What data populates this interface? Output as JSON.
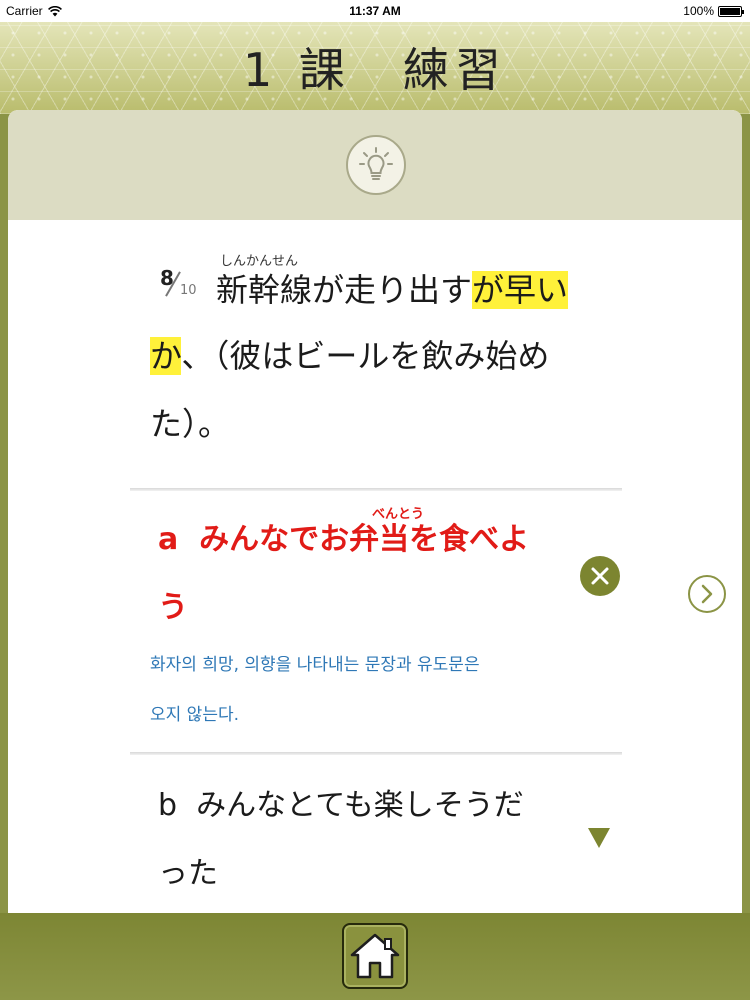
{
  "status_bar": {
    "carrier": "Carrier",
    "time": "11:37 AM",
    "battery": "100%"
  },
  "header": {
    "title": "1 課　練習"
  },
  "question": {
    "number": "8",
    "total": "10",
    "ruby": "しんかんせん",
    "line1_before": "新幹線が走り出す",
    "line1_highlight": "が早い",
    "line2_highlight": "か",
    "line2_after": "、（彼はビールを飲み始め",
    "line3": "た）。"
  },
  "option_a": {
    "ruby": "べんとう",
    "line1": "a  みんなでお弁当を食べよ",
    "line2": "う",
    "explanation_line1": "화자의 희망, 의향을 나타내는 문장과 유도문은",
    "explanation_line2": "오지 않는다."
  },
  "option_b": {
    "line1": "b  みんなとても楽しそうだ",
    "line2": "った"
  },
  "icons": {
    "hint": "lightbulb-icon",
    "wrong": "close-circle-icon",
    "next": "chevron-right-icon",
    "scroll": "triangle-down-icon",
    "home": "home-icon"
  },
  "colors": {
    "accent_olive": "#8b9445",
    "highlight_yellow": "#fff13a",
    "wrong_red": "#e11b17",
    "explanation_blue": "#2f78b6"
  }
}
